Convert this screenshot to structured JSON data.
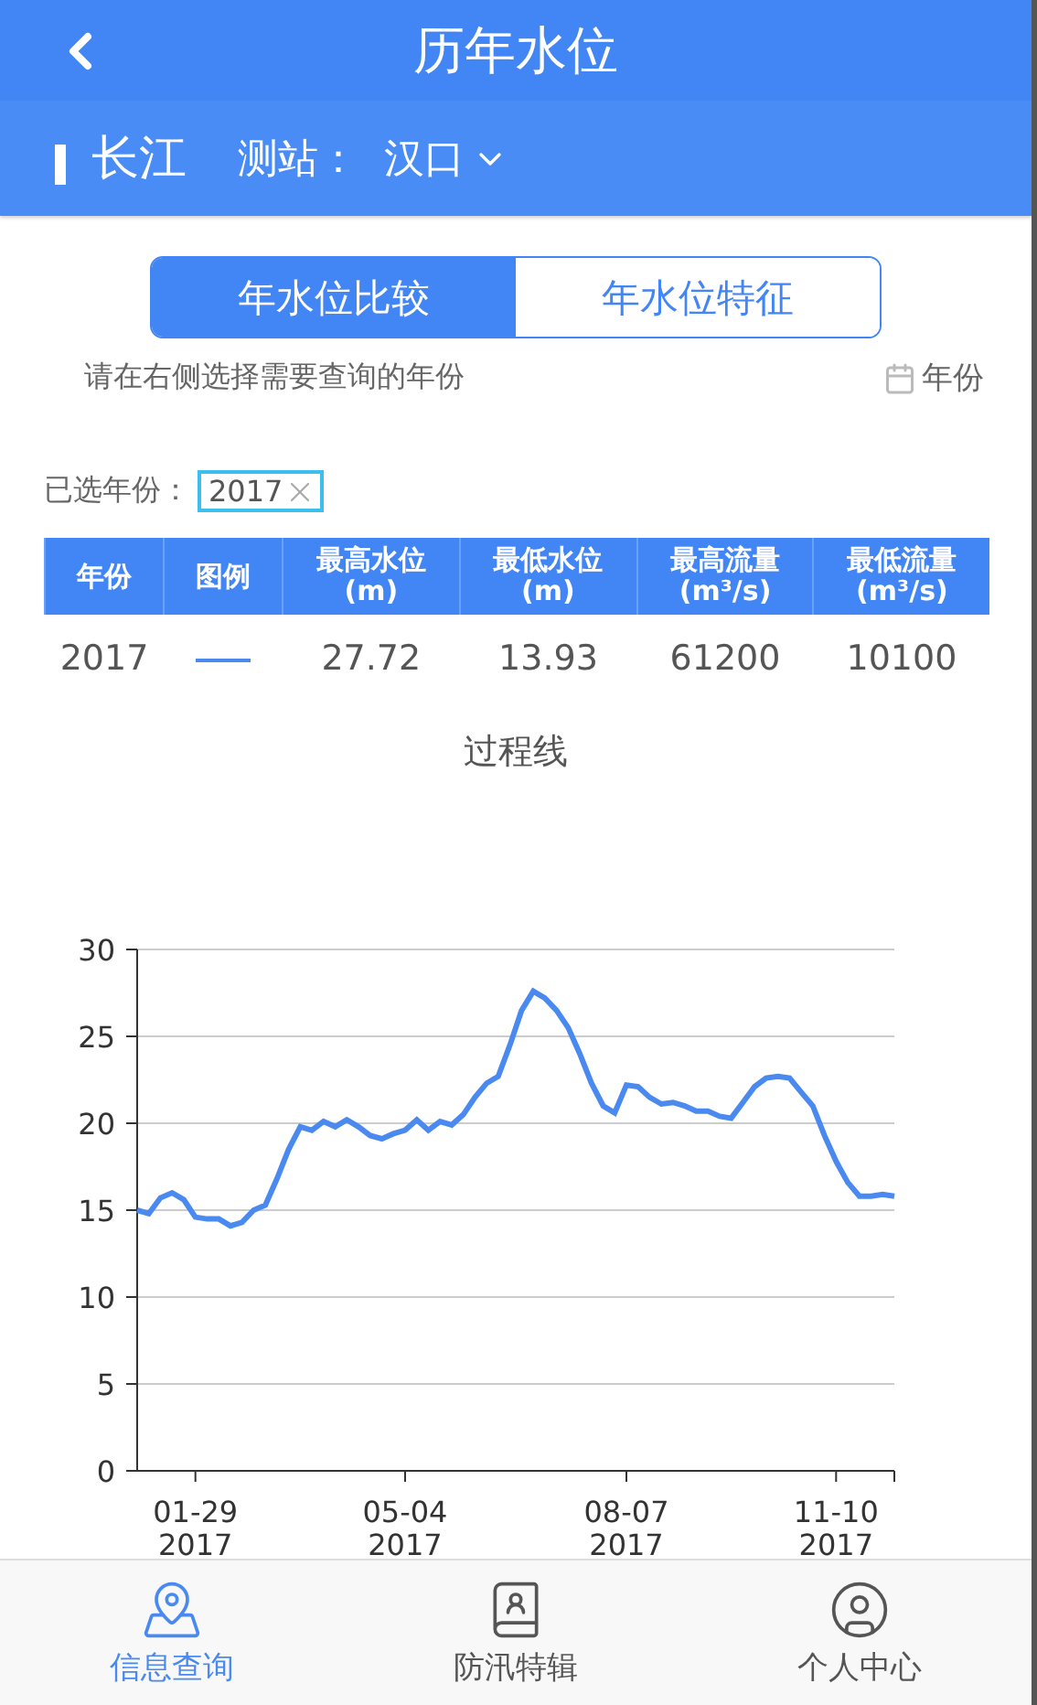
{
  "header": {
    "title": "历年水位"
  },
  "station_bar": {
    "river": "长江",
    "station_label": "测站：",
    "station": "汉口"
  },
  "segments": [
    {
      "label": "年水位比较",
      "selected": true
    },
    {
      "label": "年水位特征",
      "selected": false
    }
  ],
  "hint": "请在右侧选择需要查询的年份",
  "year_picker": "年份",
  "selected_years": {
    "label": "已选年份：",
    "tags": [
      "2017"
    ]
  },
  "table": {
    "columns": [
      "年份",
      "图例",
      "最高水位\n(m)",
      "最低水位\n(m)",
      "最高流量\n(m³/s)",
      "最低流量\n(m³/s)"
    ],
    "rows": [
      {
        "year": "2017",
        "max_level": "27.72",
        "min_level": "13.93",
        "max_flow": "61200",
        "min_flow": "10100"
      }
    ]
  },
  "chart": {
    "title": "过程线",
    "chart_data": {
      "type": "line",
      "categories": [
        null,
        null,
        null,
        null,
        null,
        "01-29\n2017",
        null,
        null,
        null,
        null,
        null,
        null,
        null,
        null,
        null,
        null,
        null,
        null,
        null,
        null,
        null,
        null,
        null,
        "05-04\n2017",
        null,
        null,
        null,
        null,
        null,
        null,
        null,
        null,
        null,
        null,
        null,
        null,
        null,
        null,
        null,
        null,
        null,
        null,
        "08-07\n2017",
        null,
        null,
        null,
        null,
        null,
        null,
        null,
        null,
        null,
        null,
        null,
        null,
        null,
        null,
        null,
        null,
        null,
        "11-10\n2017",
        null,
        null,
        null,
        null,
        null
      ],
      "series": [
        {
          "color": "#4a8af0",
          "values": [
            15,
            14.8,
            15.7,
            16,
            15.6,
            14.6,
            14.5,
            14.5,
            14.1,
            14.3,
            15,
            15.3,
            16.8,
            18.5,
            19.8,
            19.6,
            20.1,
            19.8,
            20.2,
            19.8,
            19.3,
            19.1,
            19.4,
            19.6,
            20.2,
            19.6,
            20.1,
            19.9,
            20.5,
            21.5,
            22.3,
            22.7,
            24.5,
            26.5,
            27.6,
            27.2,
            26.5,
            25.5,
            24,
            22.3,
            21,
            20.6,
            22.2,
            22.1,
            21.5,
            21.1,
            21.2,
            21,
            20.7,
            20.7,
            20.4,
            20.3,
            21.2,
            22.1,
            22.6,
            22.7,
            22.6,
            21.8,
            21,
            19.3,
            17.8,
            16.6,
            15.8,
            15.8,
            15.9,
            15.8
          ]
        }
      ],
      "ylim": [
        0,
        30
      ],
      "grid": true,
      "yticks": [
        0,
        5,
        10,
        15,
        20,
        25,
        30
      ]
    }
  },
  "tabbar": [
    {
      "kind": "map",
      "label": "信息查询",
      "selected": true
    },
    {
      "kind": "book",
      "label": "防汛特辑",
      "selected": false
    },
    {
      "kind": "person",
      "label": "个人中心",
      "selected": false
    }
  ]
}
